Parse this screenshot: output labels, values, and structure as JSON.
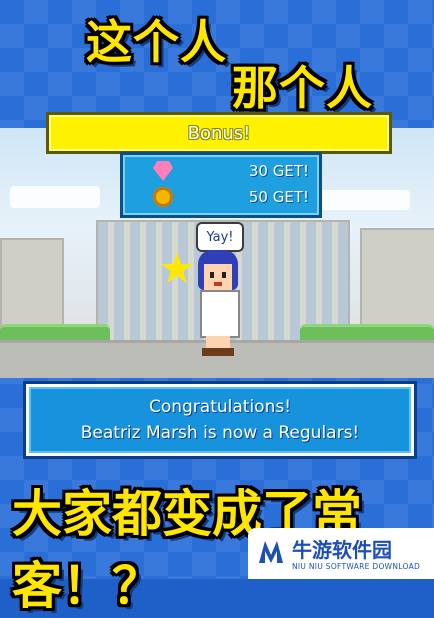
{
  "titles": {
    "line1": "这个人",
    "line2": "那个人",
    "line3": "大家都变成了常客！？"
  },
  "bonus": {
    "label": "Bonus!",
    "rewards": [
      {
        "icon": "gem-icon",
        "amount": "30 GET!"
      },
      {
        "icon": "coin-icon",
        "amount": "50 GET!"
      }
    ]
  },
  "speech_bubble": "Yay!",
  "message": {
    "line1": "Congratulations!",
    "line2": "Beatriz Marsh is now a Regulars!"
  },
  "watermark": {
    "title": "牛游软件园",
    "subtitle": "NIU NIU SOFTWARE DOWNLOAD"
  },
  "colors": {
    "title_yellow": "#ffe600",
    "bonus_yellow": "#fff200",
    "panel_blue": "#1792dc",
    "background_blue": "#2a6fd8"
  }
}
